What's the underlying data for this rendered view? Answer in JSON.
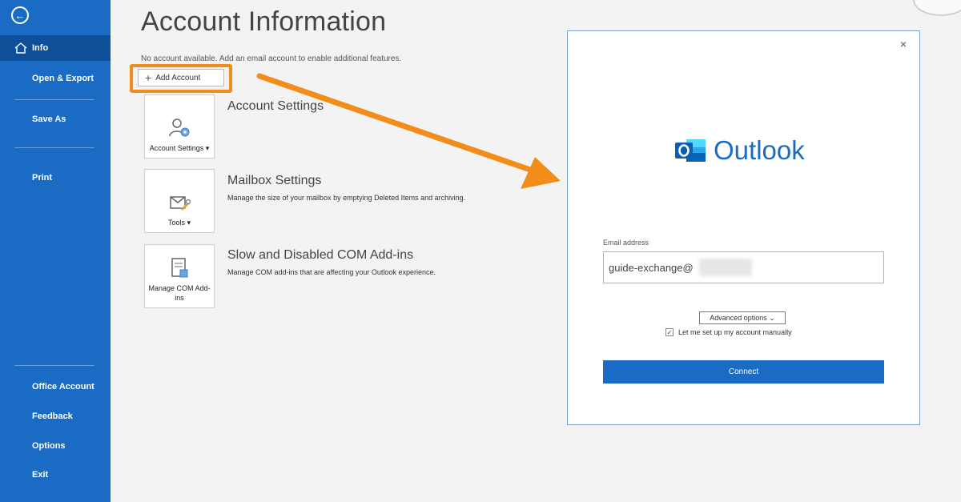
{
  "sidebar": {
    "items": [
      {
        "label": "Info"
      },
      {
        "label": "Open & Export"
      },
      {
        "label": "Save As"
      },
      {
        "label": "Print"
      },
      {
        "label": "Office Account"
      },
      {
        "label": "Feedback"
      },
      {
        "label": "Options"
      },
      {
        "label": "Exit"
      }
    ]
  },
  "main": {
    "title": "Account Information",
    "no_account_msg": "No account available. Add an email account to enable additional features.",
    "add_account_label": "Add Account",
    "sections": [
      {
        "tile_label": "Account Settings ▾",
        "title": "Account Settings",
        "desc": ""
      },
      {
        "tile_label": "Tools ▾",
        "title": "Mailbox Settings",
        "desc": "Manage the size of your mailbox by emptying Deleted Items and archiving."
      },
      {
        "tile_label": "Manage COM Add-ins",
        "title": "Slow and Disabled COM Add-ins",
        "desc": "Manage COM add-ins that are affecting your Outlook experience."
      }
    ]
  },
  "dialog": {
    "close_label": "×",
    "brand": "Outlook",
    "email_label": "Email address",
    "email_value": "guide-exchange@",
    "advanced_label": "Advanced options ⌄",
    "manual_label": "Let me set up my account manually",
    "manual_checked": true,
    "connect_label": "Connect"
  },
  "colors": {
    "sidebar": "#1a6bc4",
    "highlight": "#f28c1b",
    "brand": "#1a6bc4"
  }
}
